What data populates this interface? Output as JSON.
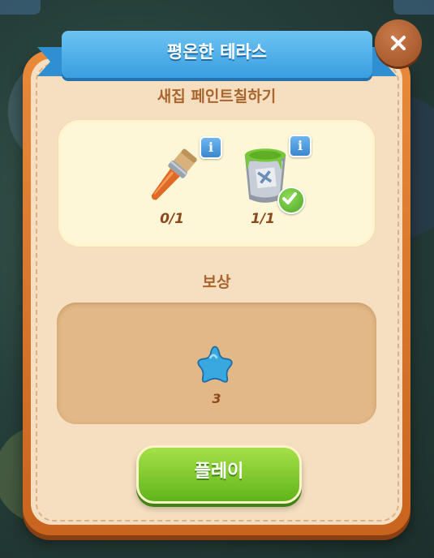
{
  "dialog": {
    "title": "평온한 테라스",
    "subtitle": "새집 페인트칠하기",
    "close_icon": "close-icon"
  },
  "tasks": [
    {
      "item": "paintbrush",
      "count": "0/1",
      "completed": false,
      "icon": "paintbrush-icon"
    },
    {
      "item": "paint-bucket",
      "count": "1/1",
      "completed": true,
      "icon": "paint-bucket-icon"
    }
  ],
  "reward": {
    "label": "보상",
    "item": "star",
    "count": "3"
  },
  "play_button": {
    "label": "플레이"
  },
  "colors": {
    "ribbon": "#3a9ee0",
    "panel_frame": "#e88a3a",
    "panel_bg": "#f6dfc0",
    "play_button": "#6cbf22",
    "star": "#3aa8e0"
  }
}
